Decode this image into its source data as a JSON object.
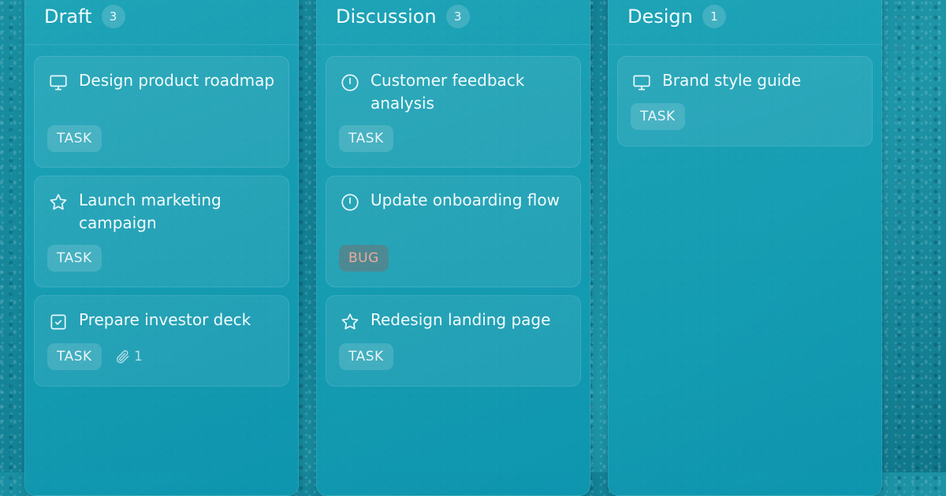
{
  "columns": [
    {
      "title": "Draft",
      "count": "3",
      "cards": [
        {
          "title": "Design product roadmap",
          "icon": "monitor-icon",
          "tag": "TASK"
        },
        {
          "title": "Launch marketing campaign",
          "icon": "star-icon",
          "tag": "TASK"
        },
        {
          "title": "Prepare investor deck",
          "icon": "checkbox-icon",
          "tag": "TASK",
          "attachments": "1"
        }
      ]
    },
    {
      "title": "Discussion",
      "count": "3",
      "cards": [
        {
          "title": "Customer feedback analysis",
          "icon": "clock-icon",
          "tag": "TASK"
        },
        {
          "title": "Update onboarding flow",
          "icon": "clock-icon",
          "tag": "BUG"
        },
        {
          "title": "Redesign landing page",
          "icon": "star-icon",
          "tag": "TASK"
        }
      ]
    },
    {
      "title": "Design",
      "count": "1",
      "cards": [
        {
          "title": "Brand style guide",
          "icon": "monitor-icon",
          "tag": "TASK"
        }
      ]
    }
  ],
  "colors": {
    "accent": "#17a0b8",
    "bug_tag_text": "#f0a99b"
  }
}
